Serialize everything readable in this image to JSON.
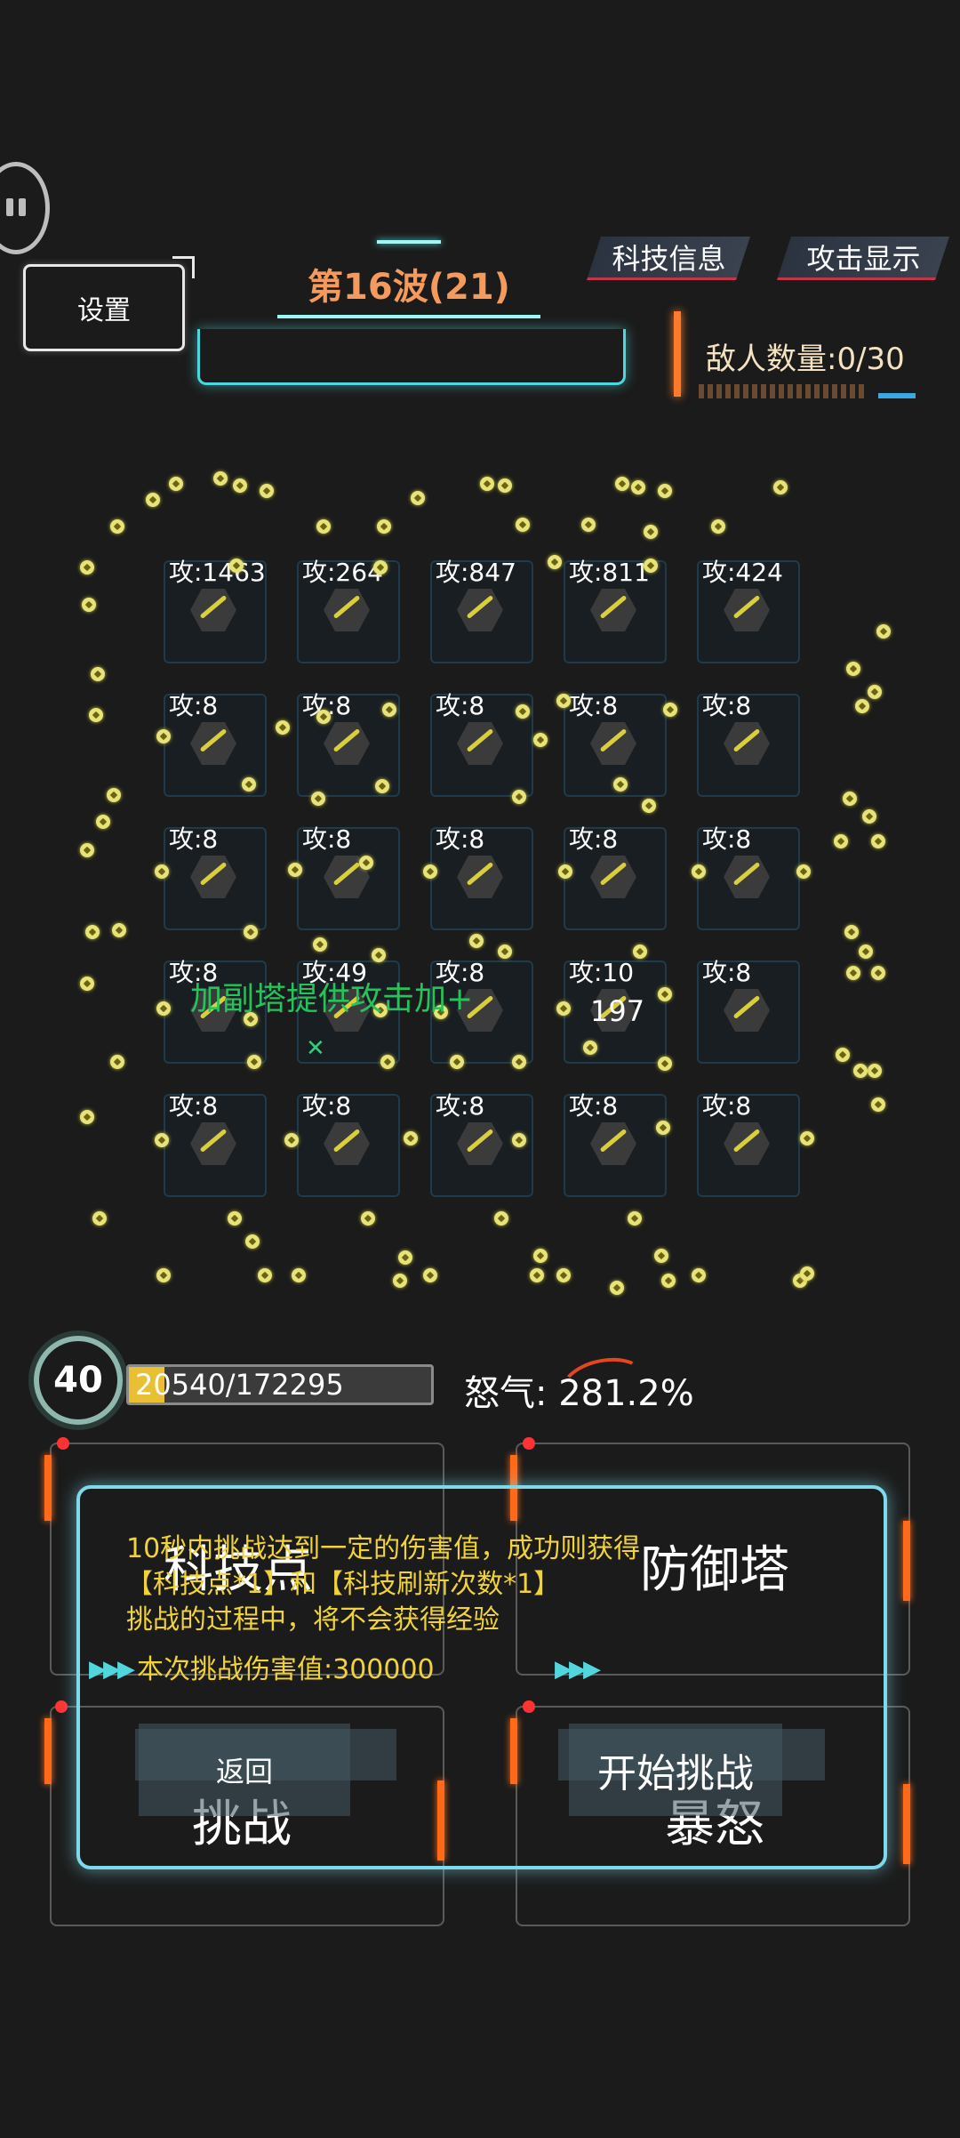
{
  "header": {
    "settings_label": "设置",
    "wave_title": "第16波(21)",
    "tab_tech": "科技信息",
    "tab_attack": "攻击显示",
    "enemy_count": "敌人数量:0/30"
  },
  "towers": [
    [
      "攻:1463",
      "攻:264",
      "攻:847",
      "攻:811",
      "攻:424"
    ],
    [
      "攻:8",
      "攻:8",
      "攻:8",
      "攻:8",
      "攻:8"
    ],
    [
      "攻:8",
      "攻:8",
      "攻:8",
      "攻:8",
      "攻:8"
    ],
    [
      "攻:8",
      "攻:49",
      "攻:8",
      "攻:10",
      "攻:8"
    ],
    [
      "攻:8",
      "攻:8",
      "攻:8",
      "攻:8",
      "攻:8"
    ]
  ],
  "floating": {
    "green_text": "加副塔提供攻击加+",
    "damage_number": "197"
  },
  "status": {
    "level": "40",
    "exp_text": "20540/172295",
    "exp_progress": 0.119,
    "rage_text": "怒气: 281.2%"
  },
  "panels": {
    "tech_point": "科技点",
    "defense_tower": "防御塔",
    "challenge": "挑战",
    "rage": "暴怒"
  },
  "dialog": {
    "line1": "10秒内挑战达到一定的伤害值，成功则获得",
    "line2": "【科技点*1】和【科技刷新次数*1】",
    "line3": "挑战的过程中，将不会获得经验",
    "damage_line": "本次挑战伤害值:300000",
    "return_label": "返回",
    "start_label": "开始挑战"
  },
  "colors": {
    "wave_title": "#f39a5c",
    "accent_cyan": "#4fd7dd",
    "accent_orange": "#ff6a1a",
    "dialog_text": "#f0d23a",
    "exp_fill": "#e9c033"
  }
}
